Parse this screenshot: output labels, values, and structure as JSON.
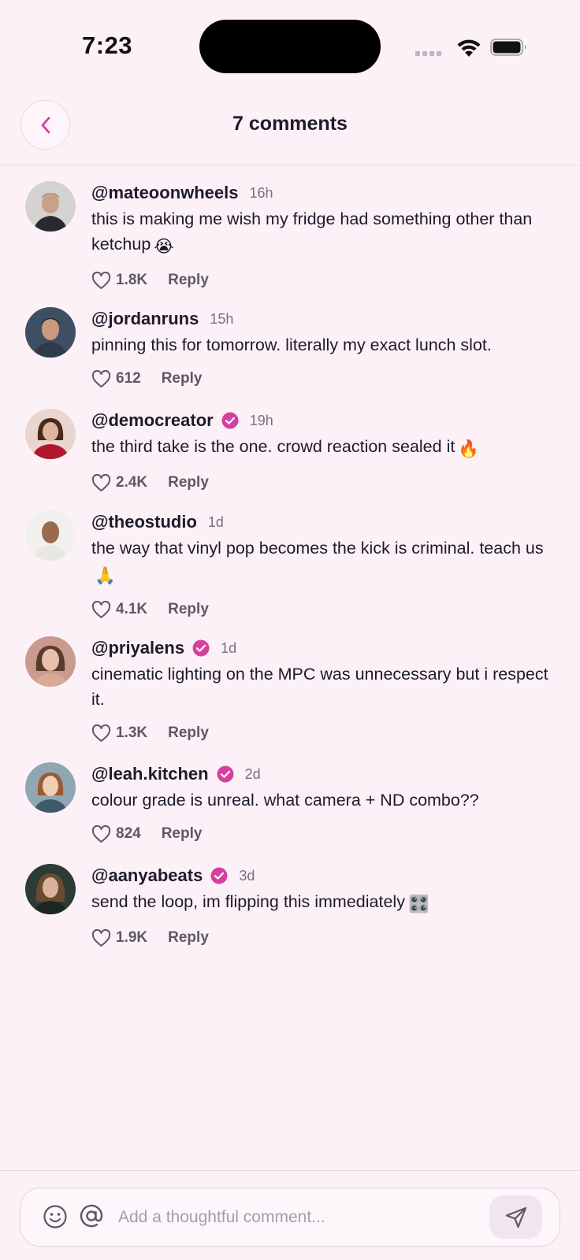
{
  "status_bar": {
    "time": "7:23"
  },
  "header": {
    "title": "7 comments"
  },
  "comments": [
    {
      "username": "@mateoonwheels",
      "time": "16h",
      "text": "this is making me wish my fridge had something other than ketchup",
      "emoji": "😭",
      "likes": "1.8K",
      "reply": "Reply",
      "verified": false
    },
    {
      "username": "@jordanruns",
      "time": "15h",
      "text": "pinning this for tomorrow. literally my exact lunch slot.",
      "emoji": "",
      "likes": "612",
      "reply": "Reply",
      "verified": false
    },
    {
      "username": "@democreator",
      "time": "19h",
      "text": "the third take is the one. crowd reaction sealed it",
      "emoji": "🔥",
      "likes": "2.4K",
      "reply": "Reply",
      "verified": true
    },
    {
      "username": "@theostudio",
      "time": "1d",
      "text": "the way that vinyl pop becomes the kick is criminal. teach us",
      "emoji": "🙏",
      "likes": "4.1K",
      "reply": "Reply",
      "verified": false
    },
    {
      "username": "@priyalens",
      "time": "1d",
      "text": "cinematic lighting on the MPC was unnecessary but i respect it.",
      "emoji": "",
      "likes": "1.3K",
      "reply": "Reply",
      "verified": true
    },
    {
      "username": "@leah.kitchen",
      "time": "2d",
      "text": "colour grade is unreal. what camera + ND combo??",
      "emoji": "",
      "likes": "824",
      "reply": "Reply",
      "verified": true
    },
    {
      "username": "@aanyabeats",
      "time": "3d",
      "text": "send the loop, im flipping this immediately",
      "emoji": "🎛️",
      "likes": "1.9K",
      "reply": "Reply",
      "verified": true
    }
  ],
  "composer": {
    "placeholder": "Add a thoughtful comment..."
  },
  "colors": {
    "accent": "#d63fa0",
    "background": "#fdf1f8",
    "text": "#1d1b2a",
    "muted": "#5d5866"
  },
  "icons": {
    "back": "chevron-left-icon",
    "verified": "verified-badge-icon",
    "like": "heart-icon",
    "emoji": "smiley-icon",
    "mention": "at-icon",
    "send": "send-icon"
  }
}
